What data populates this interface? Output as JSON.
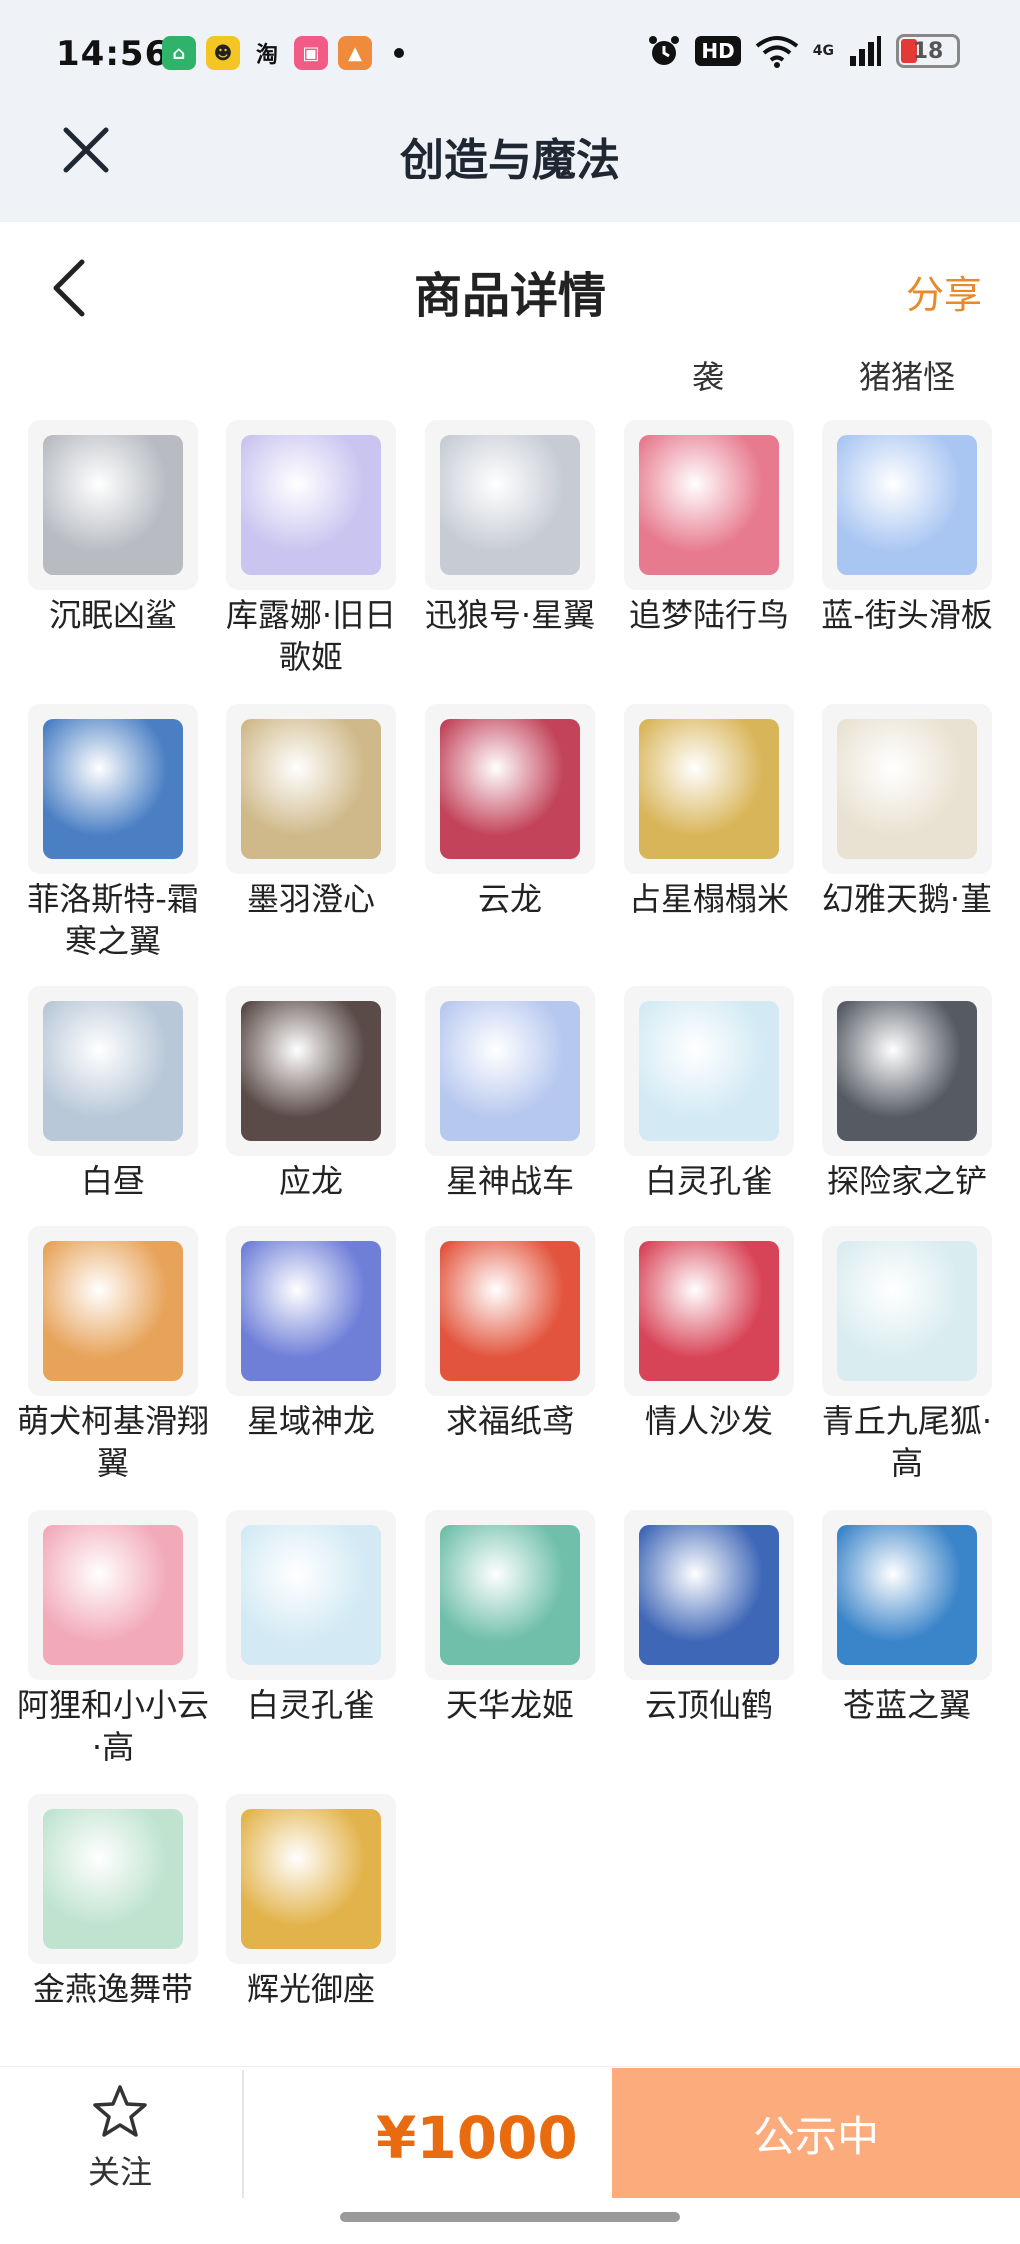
{
  "status_bar": {
    "time": "14:56",
    "network": "4G",
    "hd": "HD",
    "battery": "18"
  },
  "app_bar": {
    "title": "创造与魔法"
  },
  "header": {
    "title": "商品详情",
    "share_label": "分享"
  },
  "prev_labels": [
    "袭",
    "猪猪怪"
  ],
  "items": [
    {
      "name": "沉眠凶鲨",
      "icon": "shark-art",
      "color": "#b8bcc2"
    },
    {
      "name": "库露娜·旧日歌姬",
      "icon": "singer-art",
      "color": "#c9c4f0"
    },
    {
      "name": "迅狼号·星翼",
      "icon": "mecha-wolf-art",
      "color": "#c7ccd4"
    },
    {
      "name": "追梦陆行鸟",
      "icon": "bird-art",
      "color": "#e77a8e"
    },
    {
      "name": "蓝-街头滑板",
      "icon": "skateboard-art",
      "color": "#a9c6f2"
    },
    {
      "name": "菲洛斯特-霜寒之翼",
      "icon": "frost-wing-art",
      "color": "#4a7fc4"
    },
    {
      "name": "墨羽澄心",
      "icon": "feather-staff-art",
      "color": "#cfb98a"
    },
    {
      "name": "云龙",
      "icon": "cloud-dragon-art",
      "color": "#c2435a"
    },
    {
      "name": "占星榻榻米",
      "icon": "astro-mat-art",
      "color": "#d9b559"
    },
    {
      "name": "幻雅天鹅·堇",
      "icon": "swan-art",
      "color": "#e9e2d2"
    },
    {
      "name": "白昼",
      "icon": "white-beast-art",
      "color": "#b9c8d8"
    },
    {
      "name": "应龙",
      "icon": "dark-dragon-art",
      "color": "#5a4b48"
    },
    {
      "name": "星神战车",
      "icon": "star-chariot-art",
      "color": "#b7c8ef"
    },
    {
      "name": "白灵孔雀",
      "icon": "white-peacock-art",
      "color": "#d3eaf4"
    },
    {
      "name": "探险家之铲",
      "icon": "shovel-art",
      "color": "#555a63"
    },
    {
      "name": "萌犬柯基滑翔翼",
      "icon": "corgi-glider-art",
      "color": "#e7a35a"
    },
    {
      "name": "星域神龙",
      "icon": "star-dragon-art",
      "color": "#6f7fd8"
    },
    {
      "name": "求福纸鸢",
      "icon": "goldfish-kite-art",
      "color": "#e2543d"
    },
    {
      "name": "情人沙发",
      "icon": "sofa-art",
      "color": "#d84457"
    },
    {
      "name": "青丘九尾狐·高",
      "icon": "nine-tail-fox-art",
      "color": "#d9ecef"
    },
    {
      "name": "阿狸和小小云·高",
      "icon": "ahri-cloud-art",
      "color": "#f2aab9"
    },
    {
      "name": "白灵孔雀",
      "icon": "white-peacock-art",
      "color": "#d3eaf4"
    },
    {
      "name": "天华龙姬",
      "icon": "dragon-princess-art",
      "color": "#6fbfaa"
    },
    {
      "name": "云顶仙鹤",
      "icon": "crane-art",
      "color": "#3f67b7"
    },
    {
      "name": "苍蓝之翼",
      "icon": "azure-wing-art",
      "color": "#3a84c9"
    },
    {
      "name": "金燕逸舞带",
      "icon": "dance-ribbon-art",
      "color": "#bfe3cf"
    },
    {
      "name": "辉光御座",
      "icon": "throne-art",
      "color": "#e2b34b"
    }
  ],
  "bottom_bar": {
    "follow_label": "关注",
    "price": "¥1000",
    "status_label": "公示中"
  },
  "colors": {
    "accent": "#e96b10",
    "share": "#e88a2a",
    "status_button": "#fcab7c"
  }
}
